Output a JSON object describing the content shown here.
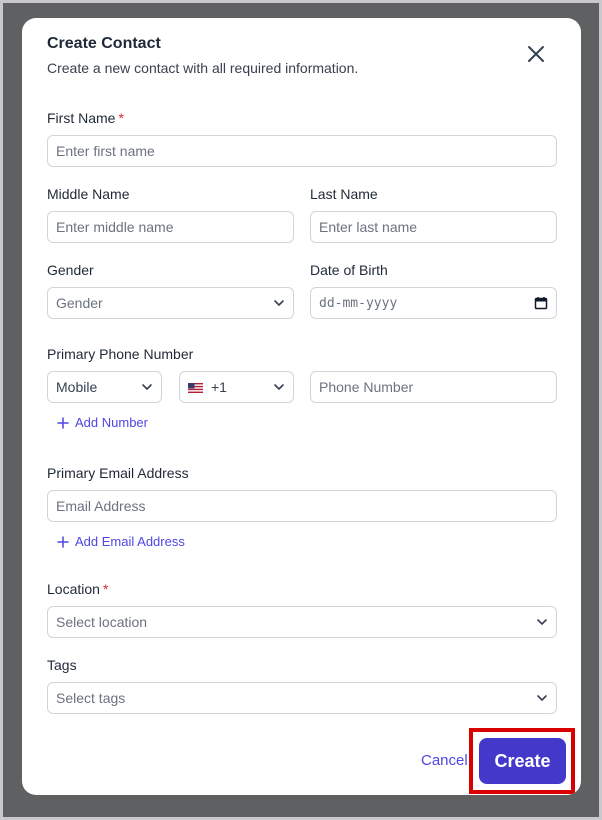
{
  "dialog": {
    "title": "Create Contact",
    "subtitle": "Create a new contact with all required information."
  },
  "form": {
    "first_name": {
      "label": "First Name",
      "required_mark": "*",
      "placeholder": "Enter first name"
    },
    "middle_name": {
      "label": "Middle Name",
      "placeholder": "Enter middle name"
    },
    "last_name": {
      "label": "Last Name",
      "placeholder": "Enter last name"
    },
    "gender": {
      "label": "Gender",
      "value": "Gender"
    },
    "dob": {
      "label": "Date of Birth",
      "placeholder": "dd-mm-yyyy"
    },
    "phone": {
      "label": "Primary Phone Number",
      "type_value": "Mobile",
      "country_code": "+1",
      "country_flag": "us-flag",
      "placeholder": "Phone Number",
      "add_label": "Add Number"
    },
    "email": {
      "label": "Primary Email Address",
      "placeholder": "Email Address",
      "add_label": "Add Email Address"
    },
    "location": {
      "label": "Location",
      "required_mark": "*",
      "placeholder": "Select location"
    },
    "tags": {
      "label": "Tags",
      "placeholder": "Select tags"
    }
  },
  "footer": {
    "cancel_label": "Cancel",
    "create_label": "Create"
  },
  "colors": {
    "accent": "#4338ca",
    "link": "#4f46e5",
    "required": "#dc2626",
    "highlight": "#d90000"
  }
}
